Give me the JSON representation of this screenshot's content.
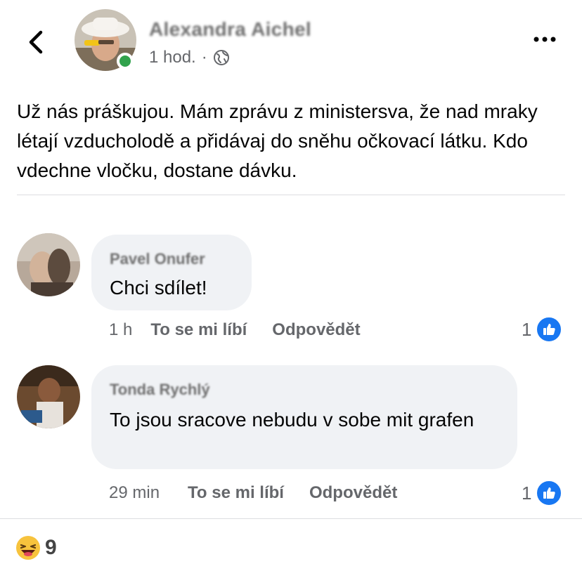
{
  "post": {
    "author": "Alexandra Aichel",
    "time": "1 hod.",
    "separator": "·",
    "text": "Už nás práškujou. Mám zprávu z ministersva, že nad mraky létají vzducholodě a přidávaj do sněhu očkovací látku. Kdo vdechne vločku, dostane dávku."
  },
  "comments": [
    {
      "author": "Pavel Onufer",
      "text": "Chci sdílet!",
      "time": "1 h",
      "like_label": "To se mi líbí",
      "reply_label": "Odpovědět",
      "likes": "1"
    },
    {
      "author": "Tonda Rychlý",
      "text": "To jsou sracove nebudu v sobe mit grafen",
      "time": "29 min",
      "like_label": "To se mi líbí",
      "reply_label": "Odpovědět",
      "likes": "1"
    }
  ],
  "reactions": {
    "emoji": "😜",
    "count": "9"
  },
  "icons": {
    "back": "chevron-left-icon",
    "more": "more-horizontal-icon",
    "privacy": "globe-icon",
    "like": "thumbs-up-icon"
  },
  "colors": {
    "like_blue": "#1877f2",
    "online_green": "#31a24c",
    "bubble_gray": "#f0f2f5",
    "secondary_text": "#65676b"
  }
}
